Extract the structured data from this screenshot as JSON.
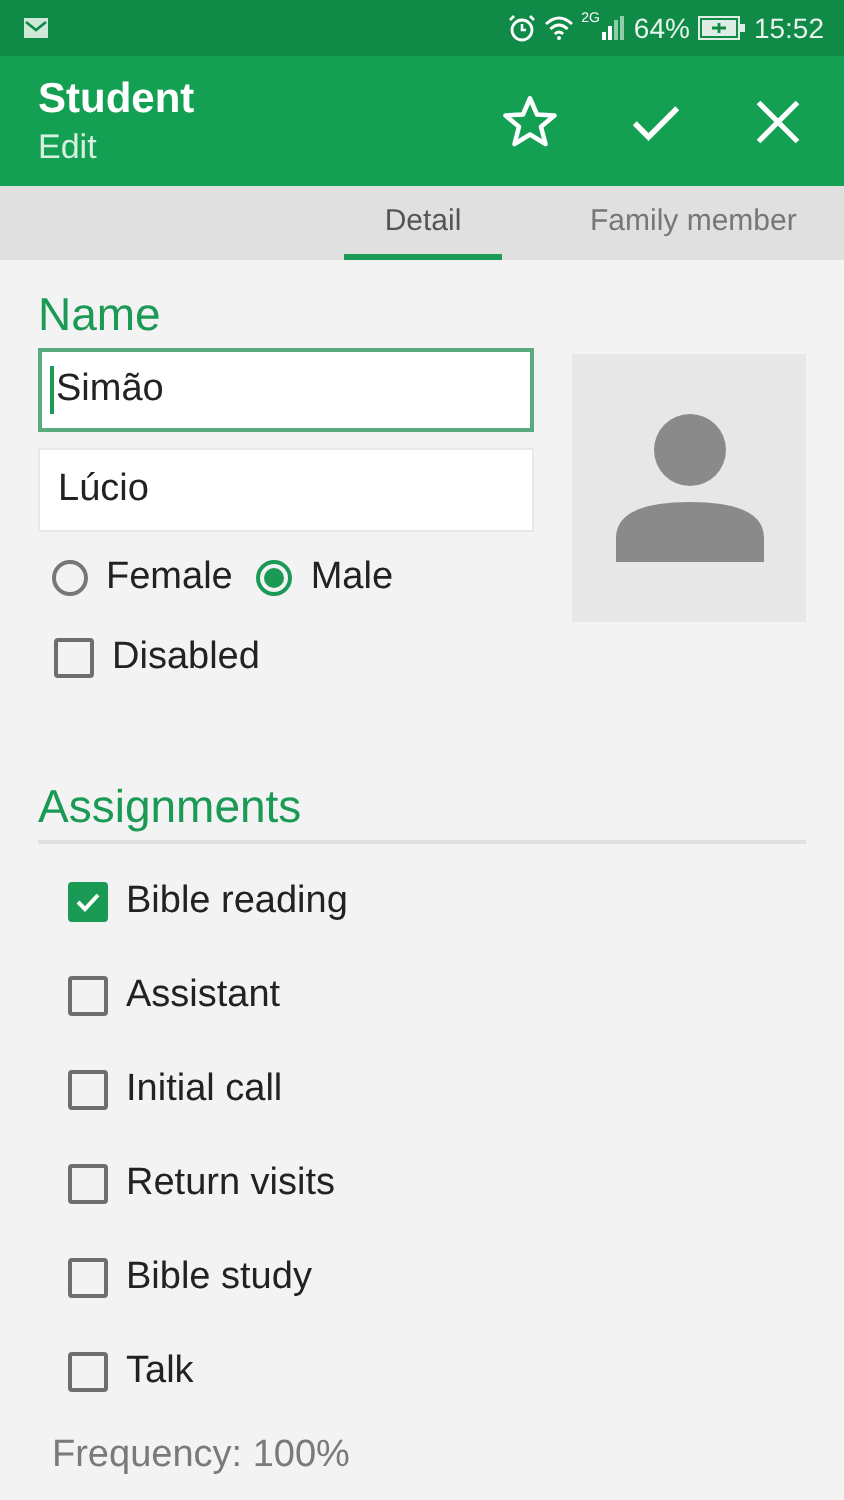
{
  "status_bar": {
    "network": "2G",
    "battery": "64%",
    "time": "15:52"
  },
  "toolbar": {
    "title": "Student",
    "subtitle": "Edit"
  },
  "tabs": [
    {
      "label": "Detail",
      "selected": true
    },
    {
      "label": "Family member",
      "selected": false
    }
  ],
  "name_section": {
    "heading": "Name",
    "first_name": {
      "value": "Simão",
      "focused": true
    },
    "last_name": {
      "value": "Lúcio",
      "focused": false
    }
  },
  "gender": [
    {
      "label": "Female",
      "selected": false
    },
    {
      "label": "Male",
      "selected": true
    }
  ],
  "disabled": {
    "label": "Disabled",
    "checked": false
  },
  "assignments": {
    "heading": "Assignments",
    "items": [
      {
        "label": "Bible reading",
        "checked": true
      },
      {
        "label": "Assistant",
        "checked": false
      },
      {
        "label": "Initial call",
        "checked": false
      },
      {
        "label": "Return visits",
        "checked": false
      },
      {
        "label": "Bible study",
        "checked": false
      },
      {
        "label": "Talk",
        "checked": false
      }
    ],
    "frequency": "Frequency: 100%"
  }
}
